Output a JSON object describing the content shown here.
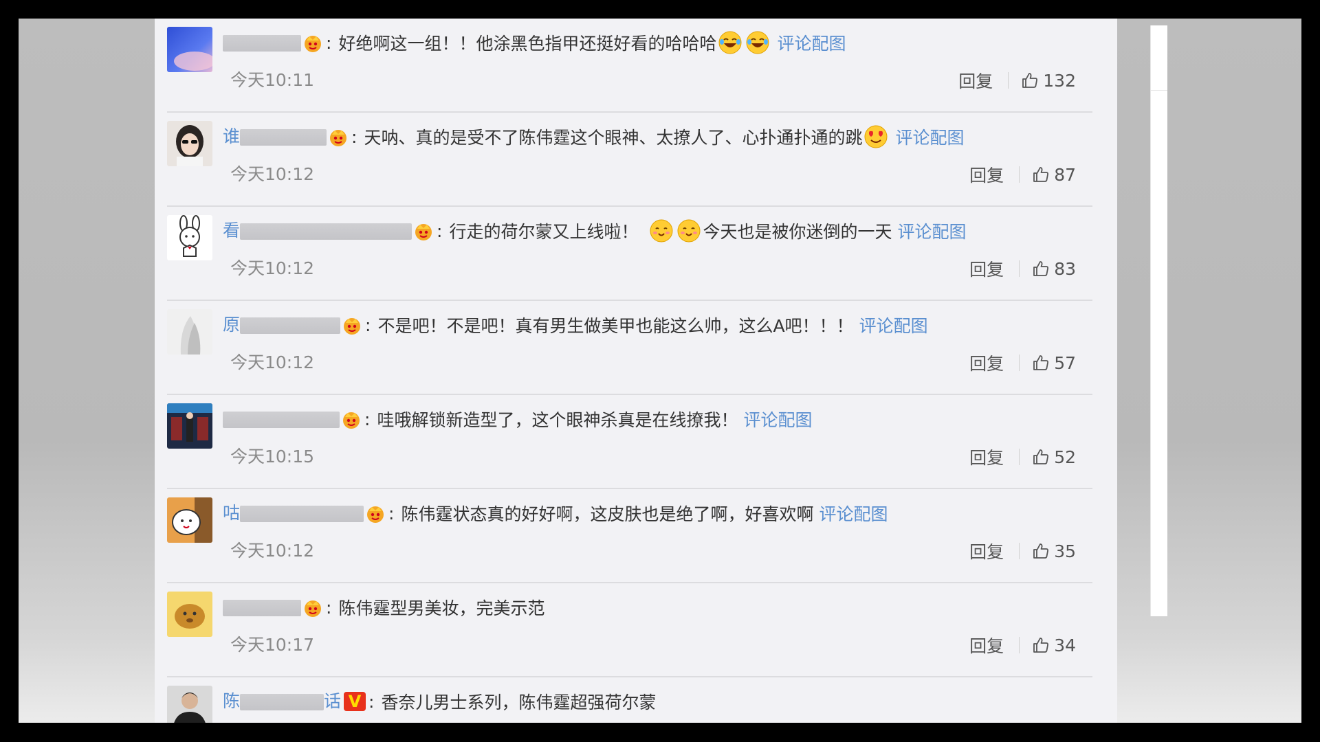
{
  "reply_label": "回复",
  "pic_link_label": "评论配图",
  "colors": {
    "link": "#5a8fd0",
    "text": "#333333",
    "meta": "#8a8a8a",
    "panel_bg": "#f2f2f5"
  },
  "comments": [
    {
      "username_visible": "",
      "badge": "crown-icon",
      "text": "好绝啊这一组！！他涂黑色指甲还挺好看的哈哈哈",
      "emojis": [
        "laughing-tears-emoji",
        "laughing-tears-emoji"
      ],
      "emoji_after_text": "",
      "has_pic": true,
      "time": "今天10:11",
      "likes": "132"
    },
    {
      "username_visible": "谁",
      "badge": "crown-icon",
      "text": "天呐、真的是受不了陈伟霆这个眼神、太撩人了、心扑通扑通的跳",
      "emojis": [
        "heart-eyes-emoji"
      ],
      "emoji_after_text": "",
      "has_pic": true,
      "time": "今天10:12",
      "likes": "87"
    },
    {
      "username_visible": "看",
      "badge": "crown-icon",
      "text": "行走的荷尔蒙又上线啦！",
      "emojis": [
        "shy-smile-emoji",
        "shy-smile-emoji"
      ],
      "emoji_after_text": "今天也是被你迷倒的一天",
      "has_pic": true,
      "time": "今天10:12",
      "likes": "83"
    },
    {
      "username_visible": "原",
      "badge": "crown-icon",
      "text": "不是吧！不是吧！真有男生做美甲也能这么帅，这么A吧！！！",
      "emojis": [],
      "emoji_after_text": "",
      "has_pic": true,
      "time": "今天10:12",
      "likes": "57"
    },
    {
      "username_visible": "",
      "badge": "crown-icon",
      "text": "哇哦解锁新造型了，这个眼神杀真是在线撩我！",
      "emojis": [],
      "emoji_after_text": "",
      "has_pic": true,
      "time": "今天10:15",
      "likes": "52"
    },
    {
      "username_visible": "咕",
      "badge": "crown-icon",
      "text": "陈伟霆状态真的好好啊，这皮肤也是绝了啊，好喜欢啊",
      "emojis": [],
      "emoji_after_text": "",
      "has_pic": true,
      "time": "今天10:12",
      "likes": "35"
    },
    {
      "username_visible": "",
      "badge": "crown-icon",
      "text": "陈伟霆型男美妆，完美示范",
      "emojis": [],
      "emoji_after_text": "",
      "has_pic": false,
      "time": "今天10:17",
      "likes": "34"
    },
    {
      "username_visible": "陈",
      "username_tail": "话",
      "badge": "v-badge",
      "badge_text": "V",
      "text": "香奈儿男士系列，陈伟霆超强荷尔蒙",
      "emojis": [],
      "emoji_after_text": "",
      "has_pic": false,
      "time": "",
      "likes": ""
    }
  ]
}
